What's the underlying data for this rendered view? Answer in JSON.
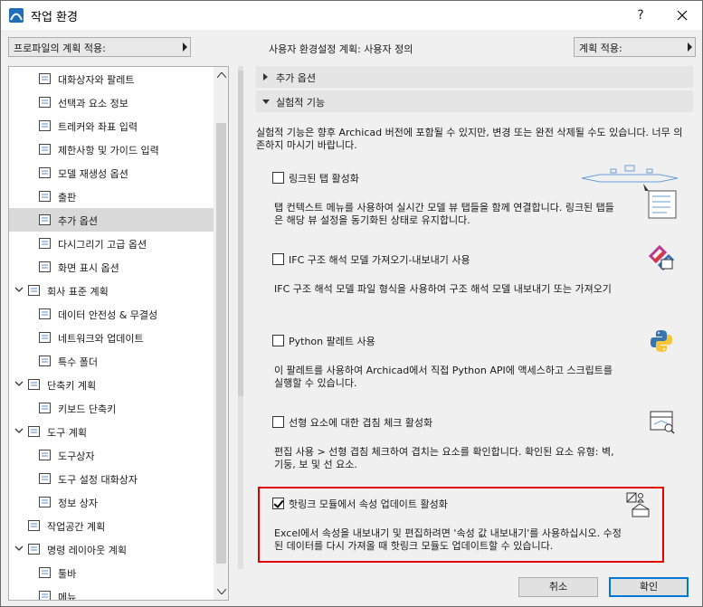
{
  "window": {
    "title": "작업 환경",
    "help_label": "?"
  },
  "top_bar": {
    "profile_combo": "프로파일의 계획 적용:",
    "scheme_label": "사용자 환경설정 계획: 사용자 정의",
    "apply_combo": "계획 적용:"
  },
  "tree": {
    "items": [
      {
        "label": "대화상자와 팔레트",
        "icon": "palette-icon"
      },
      {
        "label": "선택과 요소 정보",
        "icon": "element-info-icon"
      },
      {
        "label": "트레커와 좌표 입력",
        "icon": "tracker-icon"
      },
      {
        "label": "제한사항 및 가이드 입력",
        "icon": "guide-icon"
      },
      {
        "label": "모델 재생성 옵션",
        "icon": "model-rebuild-icon"
      },
      {
        "label": "출판",
        "icon": "publish-icon"
      },
      {
        "label": "추가 옵션",
        "icon": "more-options-icon"
      },
      {
        "label": "다시그리기 고급 옵션",
        "icon": "redraw-icon"
      },
      {
        "label": "화면 표시 옵션",
        "icon": "display-icon"
      },
      {
        "label": "회사 표준 계획",
        "icon": "company-standards-icon"
      },
      {
        "label": "데이터 안전성 & 무결성",
        "icon": "data-safety-icon"
      },
      {
        "label": "네트워크와 업데이트",
        "icon": "network-icon"
      },
      {
        "label": "특수 폴더",
        "icon": "special-folders-icon"
      },
      {
        "label": "단축키 계획",
        "icon": "shortcut-scheme-icon"
      },
      {
        "label": "키보드 단축키",
        "icon": "keyboard-shortcut-icon"
      },
      {
        "label": "도구 계획",
        "icon": "tool-scheme-icon"
      },
      {
        "label": "도구상자",
        "icon": "toolbox-icon"
      },
      {
        "label": "도구 설정 대화상자",
        "icon": "tool-settings-icon"
      },
      {
        "label": "정보 상자",
        "icon": "info-box-icon"
      },
      {
        "label": "작업공간 계획",
        "icon": "workspace-scheme-icon"
      },
      {
        "label": "명령 레이아웃 계획",
        "icon": "command-layout-icon"
      },
      {
        "label": "툴바",
        "icon": "toolbar-icon"
      },
      {
        "label": "메뉴",
        "icon": "menu-icon"
      }
    ]
  },
  "content": {
    "section_more_options": "추가 옵션",
    "section_experimental": "실험적 기능",
    "intro": "실험적 기능은 향후 Archicad 버전에 포함될 수 있지만, 변경 또는 완전 삭제될 수도 있습니다. 너무 의존하지 마시기 바랍니다.",
    "features": [
      {
        "label": "링크된 탭 활성화",
        "checked": false,
        "desc": "탭 컨텍스트 메뉴를 사용하여 실시간 모델 뷰 탭들을 함께 연결합니다. 링크된 탭들은 해당 뷰 설정을 동기화된 상태로 유지합니다."
      },
      {
        "label": "IFC 구조 해석 모델 가져오기-내보내기 사용",
        "checked": false,
        "desc": "IFC 구조 해석 모델 파일 형식을 사용하여 구조 해석 모델 내보내기 또는 가져오기"
      },
      {
        "label": "Python 팔레트 사용",
        "checked": false,
        "desc": "이 팔레트를 사용하여 Archicad에서 직접 Python API에 액세스하고 스크립트를 실행할 수 있습니다."
      },
      {
        "label": "선형 요소에 대한 겹침 체크 활성화",
        "checked": false,
        "desc": "편집 사용 > 선형 겹침 체크하여 겹치는 요소를 확인합니다. 확인된 요소 유형: 벽, 기둥, 보 및 선 요소."
      },
      {
        "label": "핫링크 모듈에서 속성 업데이트 활성화",
        "checked": true,
        "desc": "Excel에서 속성을 내보내기 및 편집하려면 '속성 값 내보내기'를 사용하십시오. 수정된 데이터를 다시 가져올 때 핫링크 모듈도 업데이트할 수 있습니다."
      }
    ]
  },
  "buttons": {
    "cancel": "취소",
    "ok": "확인"
  },
  "colors": {
    "highlight": "#e00000",
    "accent": "#0078d7",
    "selected_row": "#d9d9d9"
  }
}
